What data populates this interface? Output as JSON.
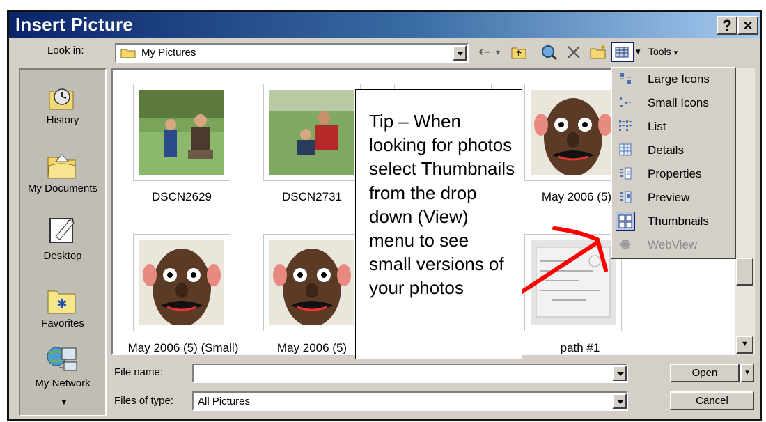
{
  "dialog": {
    "title": "Insert Picture",
    "help_label": "?",
    "close_label": "×"
  },
  "toolbar": {
    "look_in_label": "Look in:",
    "look_in_value": "My Pictures",
    "tools_label": "Tools",
    "tools_arrow": "▾",
    "views_arrow": "▾"
  },
  "places": [
    {
      "label": "History",
      "icon": "history-icon"
    },
    {
      "label": "My Documents",
      "icon": "my-documents-icon"
    },
    {
      "label": "Desktop",
      "icon": "desktop-icon"
    },
    {
      "label": "Favorites",
      "icon": "favorites-icon"
    },
    {
      "label": "My Network",
      "icon": "my-network-icon"
    }
  ],
  "files": [
    {
      "name": "DSCN2629"
    },
    {
      "name": "DSCN2731"
    },
    {
      "name": ""
    },
    {
      "name": "May 2006 (5)"
    },
    {
      "name": "May 2006 (5) (Small)"
    },
    {
      "name": "May 2006 (5)"
    },
    {
      "name": ""
    },
    {
      "name": "path #1"
    }
  ],
  "view_menu": {
    "items": [
      {
        "label": "Large Icons",
        "icon": "large-icons-icon",
        "enabled": true
      },
      {
        "label": "Small Icons",
        "icon": "small-icons-icon",
        "enabled": true
      },
      {
        "label": "List",
        "icon": "list-view-icon",
        "enabled": true
      },
      {
        "label": "Details",
        "icon": "details-view-icon",
        "enabled": true
      },
      {
        "label": "Properties",
        "icon": "properties-view-icon",
        "enabled": true
      },
      {
        "label": "Preview",
        "icon": "preview-view-icon",
        "enabled": true
      },
      {
        "label": "Thumbnails",
        "icon": "thumbnails-view-icon",
        "enabled": true,
        "selected": true
      },
      {
        "label": "WebView",
        "icon": "webview-icon",
        "enabled": false
      }
    ]
  },
  "tip": {
    "text": "Tip – When looking for photos select Thumbnails from the drop down (View) menu to see small versions of your photos"
  },
  "footer": {
    "file_name_label": "File name:",
    "file_name_value": "",
    "files_of_type_label": "Files of type:",
    "files_of_type_value": "All Pictures",
    "open_label": "Open",
    "cancel_label": "Cancel"
  },
  "colors": {
    "title_start": "#0a246a",
    "title_end": "#a6caf0",
    "dialog_face": "#d4d0c8",
    "annotation_arrow": "#ff0000"
  }
}
